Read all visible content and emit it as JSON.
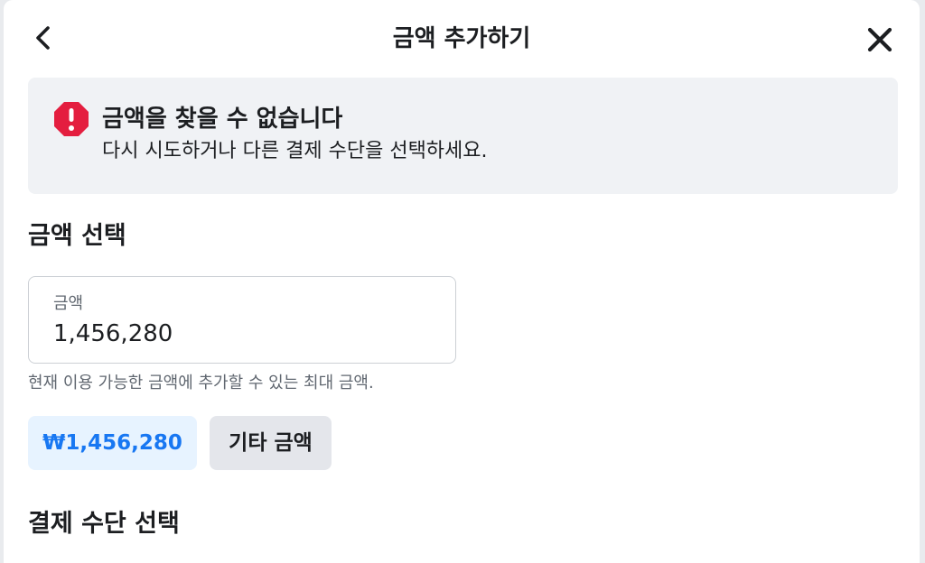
{
  "header": {
    "title": "금액 추가하기"
  },
  "alert": {
    "title": "금액을 찾을 수 없습니다",
    "message": "다시 시도하거나 다른 결제 수단을 선택하세요.",
    "icon": "error-icon",
    "color": "#e41e3f"
  },
  "amount_section": {
    "title": "금액 선택",
    "field_label": "금액",
    "field_value": "1,456,280",
    "helper_text": "현재 이용 가능한 금액에 추가할 수 있는 최대 금액.",
    "chips": {
      "selected_label": "₩1,456,280",
      "other_label": "기타 금액"
    }
  },
  "payment_section": {
    "title": "결제 수단 선택"
  },
  "colors": {
    "accent": "#1877f2",
    "accent_bg": "#e7f3ff",
    "alert_bg": "#f0f2f5",
    "text_primary": "#1c1e21",
    "text_secondary": "#606770"
  }
}
